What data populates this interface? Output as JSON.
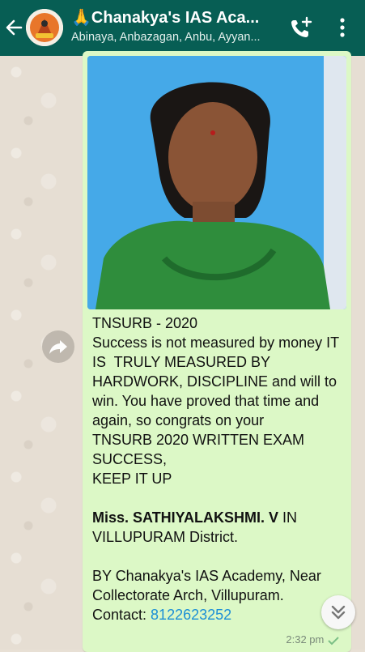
{
  "header": {
    "title": "🙏Chanakya's IAS Aca...",
    "subtitle": "Abinaya, Anbazagan, Anbu, Ayyan..."
  },
  "icons": {
    "back": "arrow-left-icon",
    "avatar": "group-avatar",
    "call": "add-call-icon",
    "more": "more-vertical-icon",
    "forward": "forward-icon",
    "scroll": "chevron-double-down-icon"
  },
  "message": {
    "line1": "TNSURB - 2020",
    "line2": "Success is not measured by money IT IS  TRULY MEASURED BY HARDWORK, DISCIPLINE and will to win. You have proved that time and again, so congrats on your",
    "line3": "TNSURB 2020 WRITTEN EXAM SUCCESS,",
    "line4": "KEEP IT UP",
    "name_bold": "Miss. SATHIYALAKSHMI. V",
    "name_rest": " IN VILLUPURAM District.",
    "by_line": "BY Chanakya's IAS Academy, Near Collectorate Arch, Villupuram.",
    "contact_label": "Contact: ",
    "contact_number": "8122623252",
    "time": "2:32 pm"
  },
  "colors": {
    "app_bar": "#075e54",
    "bubble": "#dcf8c6",
    "link": "#1b8fd6",
    "tick": "#7bbf86"
  }
}
